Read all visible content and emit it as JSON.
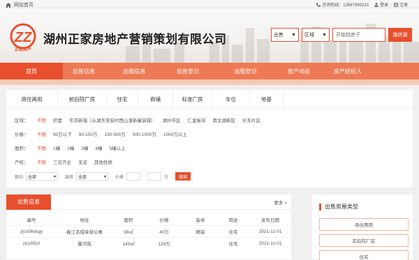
{
  "topbar": {
    "home_label": "网站首页",
    "hotline": "咨询热线：13567999233",
    "login": "登录",
    "register": "注册"
  },
  "header": {
    "logo_caption": "正家房产",
    "company_name": "湖州正家房地产营销策划有限公司",
    "type_select": "出售",
    "area_select": "区域",
    "search_placeholder": "开始找房子",
    "search_button": "搜房源"
  },
  "nav": {
    "items": [
      "首页",
      "出售信息",
      "出租信息",
      "出售登记",
      "出租登记",
      "房产动态",
      "房产经纪人"
    ]
  },
  "filter": {
    "tabs": [
      "商住两用",
      "前后院厂房",
      "住宅",
      "商铺",
      "标准厂房",
      "车位",
      "地基"
    ],
    "area": {
      "label": "区域：",
      "options": [
        "不限",
        "织里",
        "东郊新城（从湖东至荻村西山漾新童装城）",
        "湖州市区",
        "仁皇板块",
        "南太湖新区",
        "长东片区"
      ]
    },
    "price": {
      "label": "价格：",
      "options": [
        "不限",
        "90万以下",
        "90-150万",
        "150-500万",
        "500-1000万",
        "1000万以上"
      ]
    },
    "size": {
      "label": "面积：",
      "options": [
        "不限",
        "1幢",
        "2幢",
        "3幢",
        "4幢",
        "5幢以上"
      ]
    },
    "deed": {
      "label": "产权：",
      "options": [
        "不限",
        "三证齐全",
        "无证",
        "其他性质"
      ]
    },
    "controls": {
      "orientation_label": "朝向",
      "orientation_value": "全部",
      "decor_label": "装修",
      "decor_value": "全部",
      "price_label": "价格",
      "price_sep": "-",
      "price_unit": "万",
      "search_button": "搜索"
    }
  },
  "listing": {
    "title": "出售信息",
    "more": "更多 >",
    "columns": [
      "编号",
      "地址",
      "面积",
      "价格",
      "装修",
      "用途",
      "发布日期"
    ],
    "rows": [
      [
        "zjcs06dsgy",
        "春江名城单身公寓",
        "38㎡",
        "40万",
        "精装",
        "住宅",
        "2021-11-01"
      ],
      [
        "zjcs05zz",
        "馨河苑",
        "143㎡",
        "128万",
        "",
        "住宅",
        "2021-11-01"
      ]
    ]
  },
  "side": {
    "title": "出售房屋类型",
    "items": [
      "商住两用",
      "前后院厂房",
      "住宅"
    ]
  },
  "colors": {
    "accent": "#e8502d",
    "nav_bg": "#ee7a55"
  }
}
